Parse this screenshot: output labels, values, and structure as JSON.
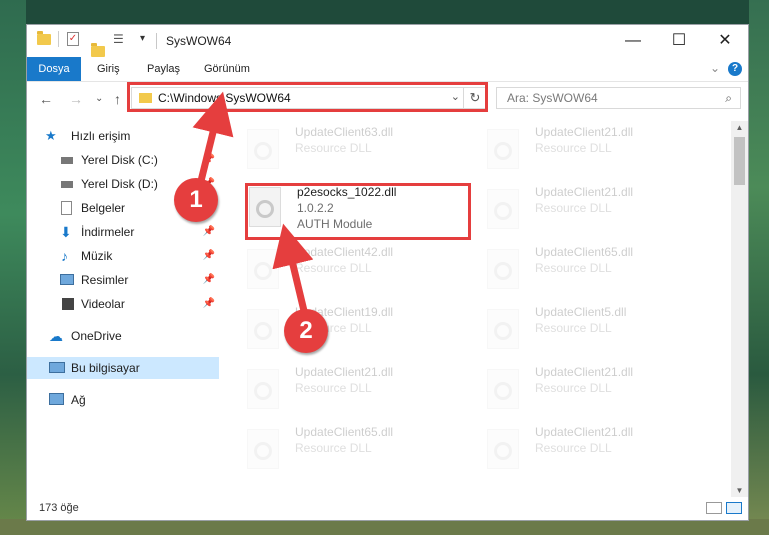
{
  "window": {
    "title": "SysWOW64",
    "minimize_glyph": "—",
    "maximize_glyph": "☐",
    "close_glyph": "✕"
  },
  "ribbon": {
    "tabs": [
      "Dosya",
      "Giriş",
      "Paylaş",
      "Görünüm"
    ],
    "help_glyph": "?"
  },
  "address": {
    "path": "C:\\Windows\\SysWOW64",
    "search_placeholder": "Ara: SysWOW64"
  },
  "sidebar": {
    "quick_access": "Hızlı erişim",
    "items": [
      {
        "label": "Yerel Disk (C:)",
        "pinned": true
      },
      {
        "label": "Yerel Disk (D:)",
        "pinned": true
      },
      {
        "label": "Belgeler",
        "pinned": true
      },
      {
        "label": "İndirmeler",
        "pinned": true
      },
      {
        "label": "Müzik",
        "pinned": true
      },
      {
        "label": "Resimler",
        "pinned": true
      },
      {
        "label": "Videolar",
        "pinned": true
      }
    ],
    "onedrive": "OneDrive",
    "this_pc": "Bu bilgisayar",
    "network": "Ağ"
  },
  "files": {
    "focused": {
      "name": "p2esocks_1022.dll",
      "version": "1.0.2.2",
      "description": "AUTH Module"
    },
    "faded": [
      {
        "name": "UpdateClient63.dll",
        "type": "Resource DLL"
      },
      {
        "name": "UpdateClient21.dll",
        "type": "Resource DLL"
      },
      {
        "name": "UpdateClient21.dll",
        "type": "Resource DLL"
      },
      {
        "name": "UpdateClient42.dll",
        "type": "Resource DLL"
      },
      {
        "name": "UpdateClient65.dll",
        "type": "Resource DLL"
      },
      {
        "name": "UpdateClient19.dll",
        "type": "Resource DLL"
      },
      {
        "name": "UpdateClient5.dll",
        "type": "Resource DLL"
      },
      {
        "name": "UpdateClient21.dll",
        "type": "Resource DLL"
      },
      {
        "name": "UpdateClient21.dll",
        "type": "Resource DLL"
      },
      {
        "name": "UpdateClient65.dll",
        "type": "Resource DLL"
      },
      {
        "name": "UpdateClient21.dll",
        "type": "Resource DLL"
      }
    ]
  },
  "status": {
    "item_count": "173 öğe"
  },
  "callouts": [
    "1",
    "2"
  ],
  "colors": {
    "accent": "#1979ca",
    "highlight": "#e53e3e",
    "selected_bg": "#cce8ff"
  }
}
